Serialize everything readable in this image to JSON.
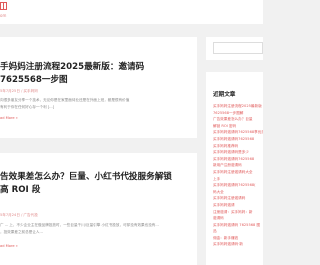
{
  "header": {
    "site_url": "om"
  },
  "posts": [
    {
      "title": "手妈妈注册流程2025最新版：邀请码7625568一步图",
      "meta": "5年7月25日 / 买手妈妈",
      "excerpt_line1": "向很多朋友分享一个技术，无论你是在家里面待业还是在外面上班，都是很有价值",
      "excerpt_line2": "有利于你在任何好心存一个利 [...]",
      "read_more": "ad More »"
    },
    {
      "title": "告效果差怎么办？巨量、小红书代投服务解锁高 ROI 段",
      "meta": "5年7月24日 / 广告代投",
      "excerpt_line1": "广 ... 上，不少企业主在做品牌投放时，一些巨量千川/巨量引擎 小红书投放，可却没有效果也没有...",
      "excerpt_line2": "，投效果差之前总是让人...",
      "read_more": "ad More »"
    }
  ],
  "sidebar": {
    "recent_title": "近期文章",
    "recent_posts": [
      "买手妈妈注册流程2025最新版",
      "7625568一步图解",
      "广告效果差怎么办？巨量",
      "解锁 ROI 密码",
      "买手妈妈邀请码7625568享优惠",
      "买手妈妈邀请码7625568",
      "买手妈妈推荐码",
      "买手妈妈邀请码是多少",
      "买手妈妈邀请码7625568",
      "新用户注册邀请码",
      "买手妈妈注册邀请码大全",
      "上手",
      "买手妈妈邀请码7625568(",
      "码大全",
      "买手妈妈注册邀请码",
      "买手妈妈邀请",
      "注册邀请：买手妈妈：新",
      "邀请码",
      "买手妈妈邀请码 7625568 图",
      "品",
      "佣金：新手赚钱",
      "买手妈妈邀请码·新"
    ]
  },
  "colors": {
    "accent": "#e05a5a",
    "meta": "#e08a8a",
    "page_bg": "#f1f1f1"
  }
}
